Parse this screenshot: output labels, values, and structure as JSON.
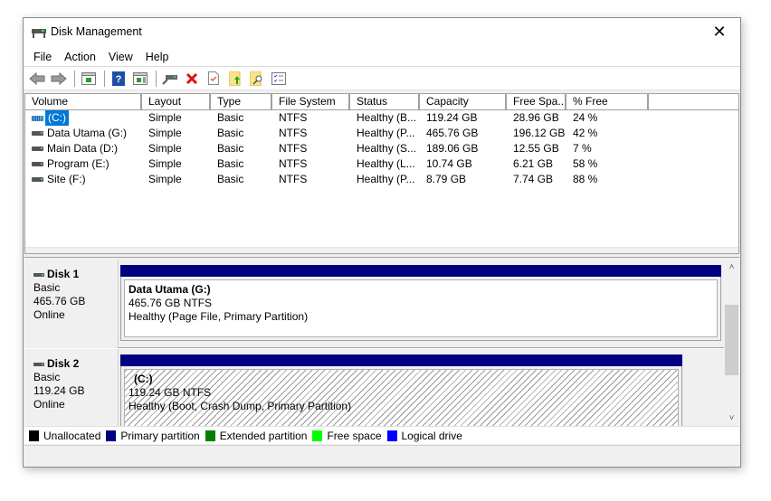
{
  "window": {
    "title": "Disk Management",
    "close_label": "✕"
  },
  "menu": [
    "File",
    "Action",
    "View",
    "Help"
  ],
  "toolbar": {
    "buttons": [
      {
        "name": "back",
        "icon": "back-arrow-icon"
      },
      {
        "name": "forward",
        "icon": "forward-arrow-icon"
      },
      {
        "name": "show-hide-console-tree",
        "icon": "console-tree-icon"
      },
      {
        "name": "help",
        "icon": "help-icon"
      },
      {
        "name": "show-hide-action-pane",
        "icon": "action-pane-icon"
      },
      {
        "name": "connect-virtual-disk",
        "icon": "disk-connect-icon"
      },
      {
        "name": "delete",
        "icon": "delete-x-icon"
      },
      {
        "name": "check",
        "icon": "check-document-icon"
      },
      {
        "name": "open-folder",
        "icon": "folder-up-icon"
      },
      {
        "name": "search-folder",
        "icon": "folder-search-icon"
      },
      {
        "name": "properties",
        "icon": "properties-list-icon"
      }
    ]
  },
  "volume_list": {
    "columns": [
      "Volume",
      "Layout",
      "Type",
      "File System",
      "Status",
      "Capacity",
      "Free Spa...",
      "% Free",
      ""
    ],
    "rows": [
      {
        "volume": "(C:)",
        "layout": "Simple",
        "type": "Basic",
        "fs": "NTFS",
        "status": "Healthy (B...",
        "capacity": "119.24 GB",
        "free": "28.96 GB",
        "pct": "24 %",
        "selected": true
      },
      {
        "volume": "Data Utama (G:)",
        "layout": "Simple",
        "type": "Basic",
        "fs": "NTFS",
        "status": "Healthy (P...",
        "capacity": "465.76 GB",
        "free": "196.12 GB",
        "pct": "42 %",
        "selected": false
      },
      {
        "volume": "Main Data (D:)",
        "layout": "Simple",
        "type": "Basic",
        "fs": "NTFS",
        "status": "Healthy (S...",
        "capacity": "189.06 GB",
        "free": "12.55 GB",
        "pct": "7 %",
        "selected": false
      },
      {
        "volume": "Program (E:)",
        "layout": "Simple",
        "type": "Basic",
        "fs": "NTFS",
        "status": "Healthy (L...",
        "capacity": "10.74 GB",
        "free": "6.21 GB",
        "pct": "58 %",
        "selected": false
      },
      {
        "volume": "Site (F:)",
        "layout": "Simple",
        "type": "Basic",
        "fs": "NTFS",
        "status": "Healthy (P...",
        "capacity": "8.79 GB",
        "free": "7.74 GB",
        "pct": "88 %",
        "selected": false
      }
    ]
  },
  "disks": [
    {
      "name": "Disk 1",
      "type": "Basic",
      "size": "465.76 GB",
      "state": "Online",
      "partition": {
        "name": "Data Utama  (G:)",
        "size_fs": "465.76 GB NTFS",
        "status": "Healthy (Page File, Primary Partition)",
        "hatched": false
      }
    },
    {
      "name": "Disk 2",
      "type": "Basic",
      "size": "119.24 GB",
      "state": "Online",
      "partition": {
        "name": "(C:)",
        "size_fs": "119.24 GB NTFS",
        "status": "Healthy (Boot, Crash Dump, Primary Partition)",
        "hatched": true
      }
    }
  ],
  "scrollbar": {
    "up": "˄",
    "down": "˅"
  },
  "legend": [
    {
      "label": "Unallocated",
      "color": "#000000"
    },
    {
      "label": "Primary partition",
      "color": "#000080"
    },
    {
      "label": "Extended partition",
      "color": "#008000"
    },
    {
      "label": "Free space",
      "color": "#00ff00"
    },
    {
      "label": "Logical drive",
      "color": "#0000ff"
    }
  ]
}
